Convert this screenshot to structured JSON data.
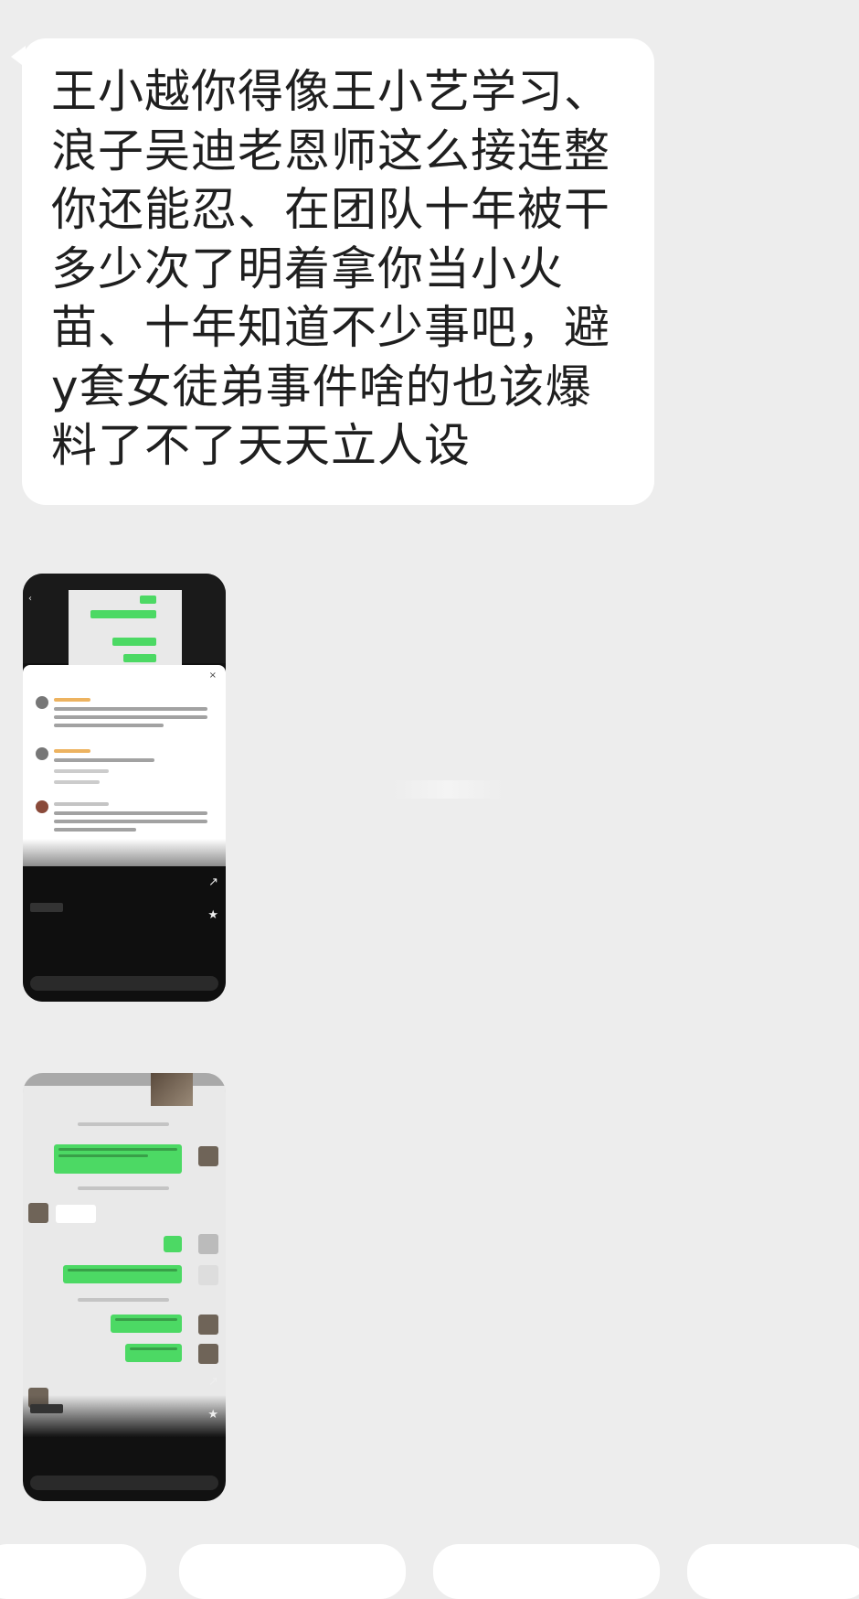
{
  "message": {
    "text": "王小越你得像王小艺学习、浪子吴迪老恩师这么接连整你还能忍、在团队十年被干多少次了明着拿你当小火苗、十年知道不少事吧，避y套女徒弟事件啥的也该爆料了不了天天立人设"
  },
  "colors": {
    "background": "#ededed",
    "bubble": "#ffffff",
    "sent_bubble": "#4cd964"
  },
  "screenshot1": {
    "icons": [
      "back-icon",
      "share-icon",
      "star-icon",
      "close-icon"
    ]
  },
  "screenshot2": {
    "icons": [
      "share-icon",
      "star-icon"
    ]
  }
}
